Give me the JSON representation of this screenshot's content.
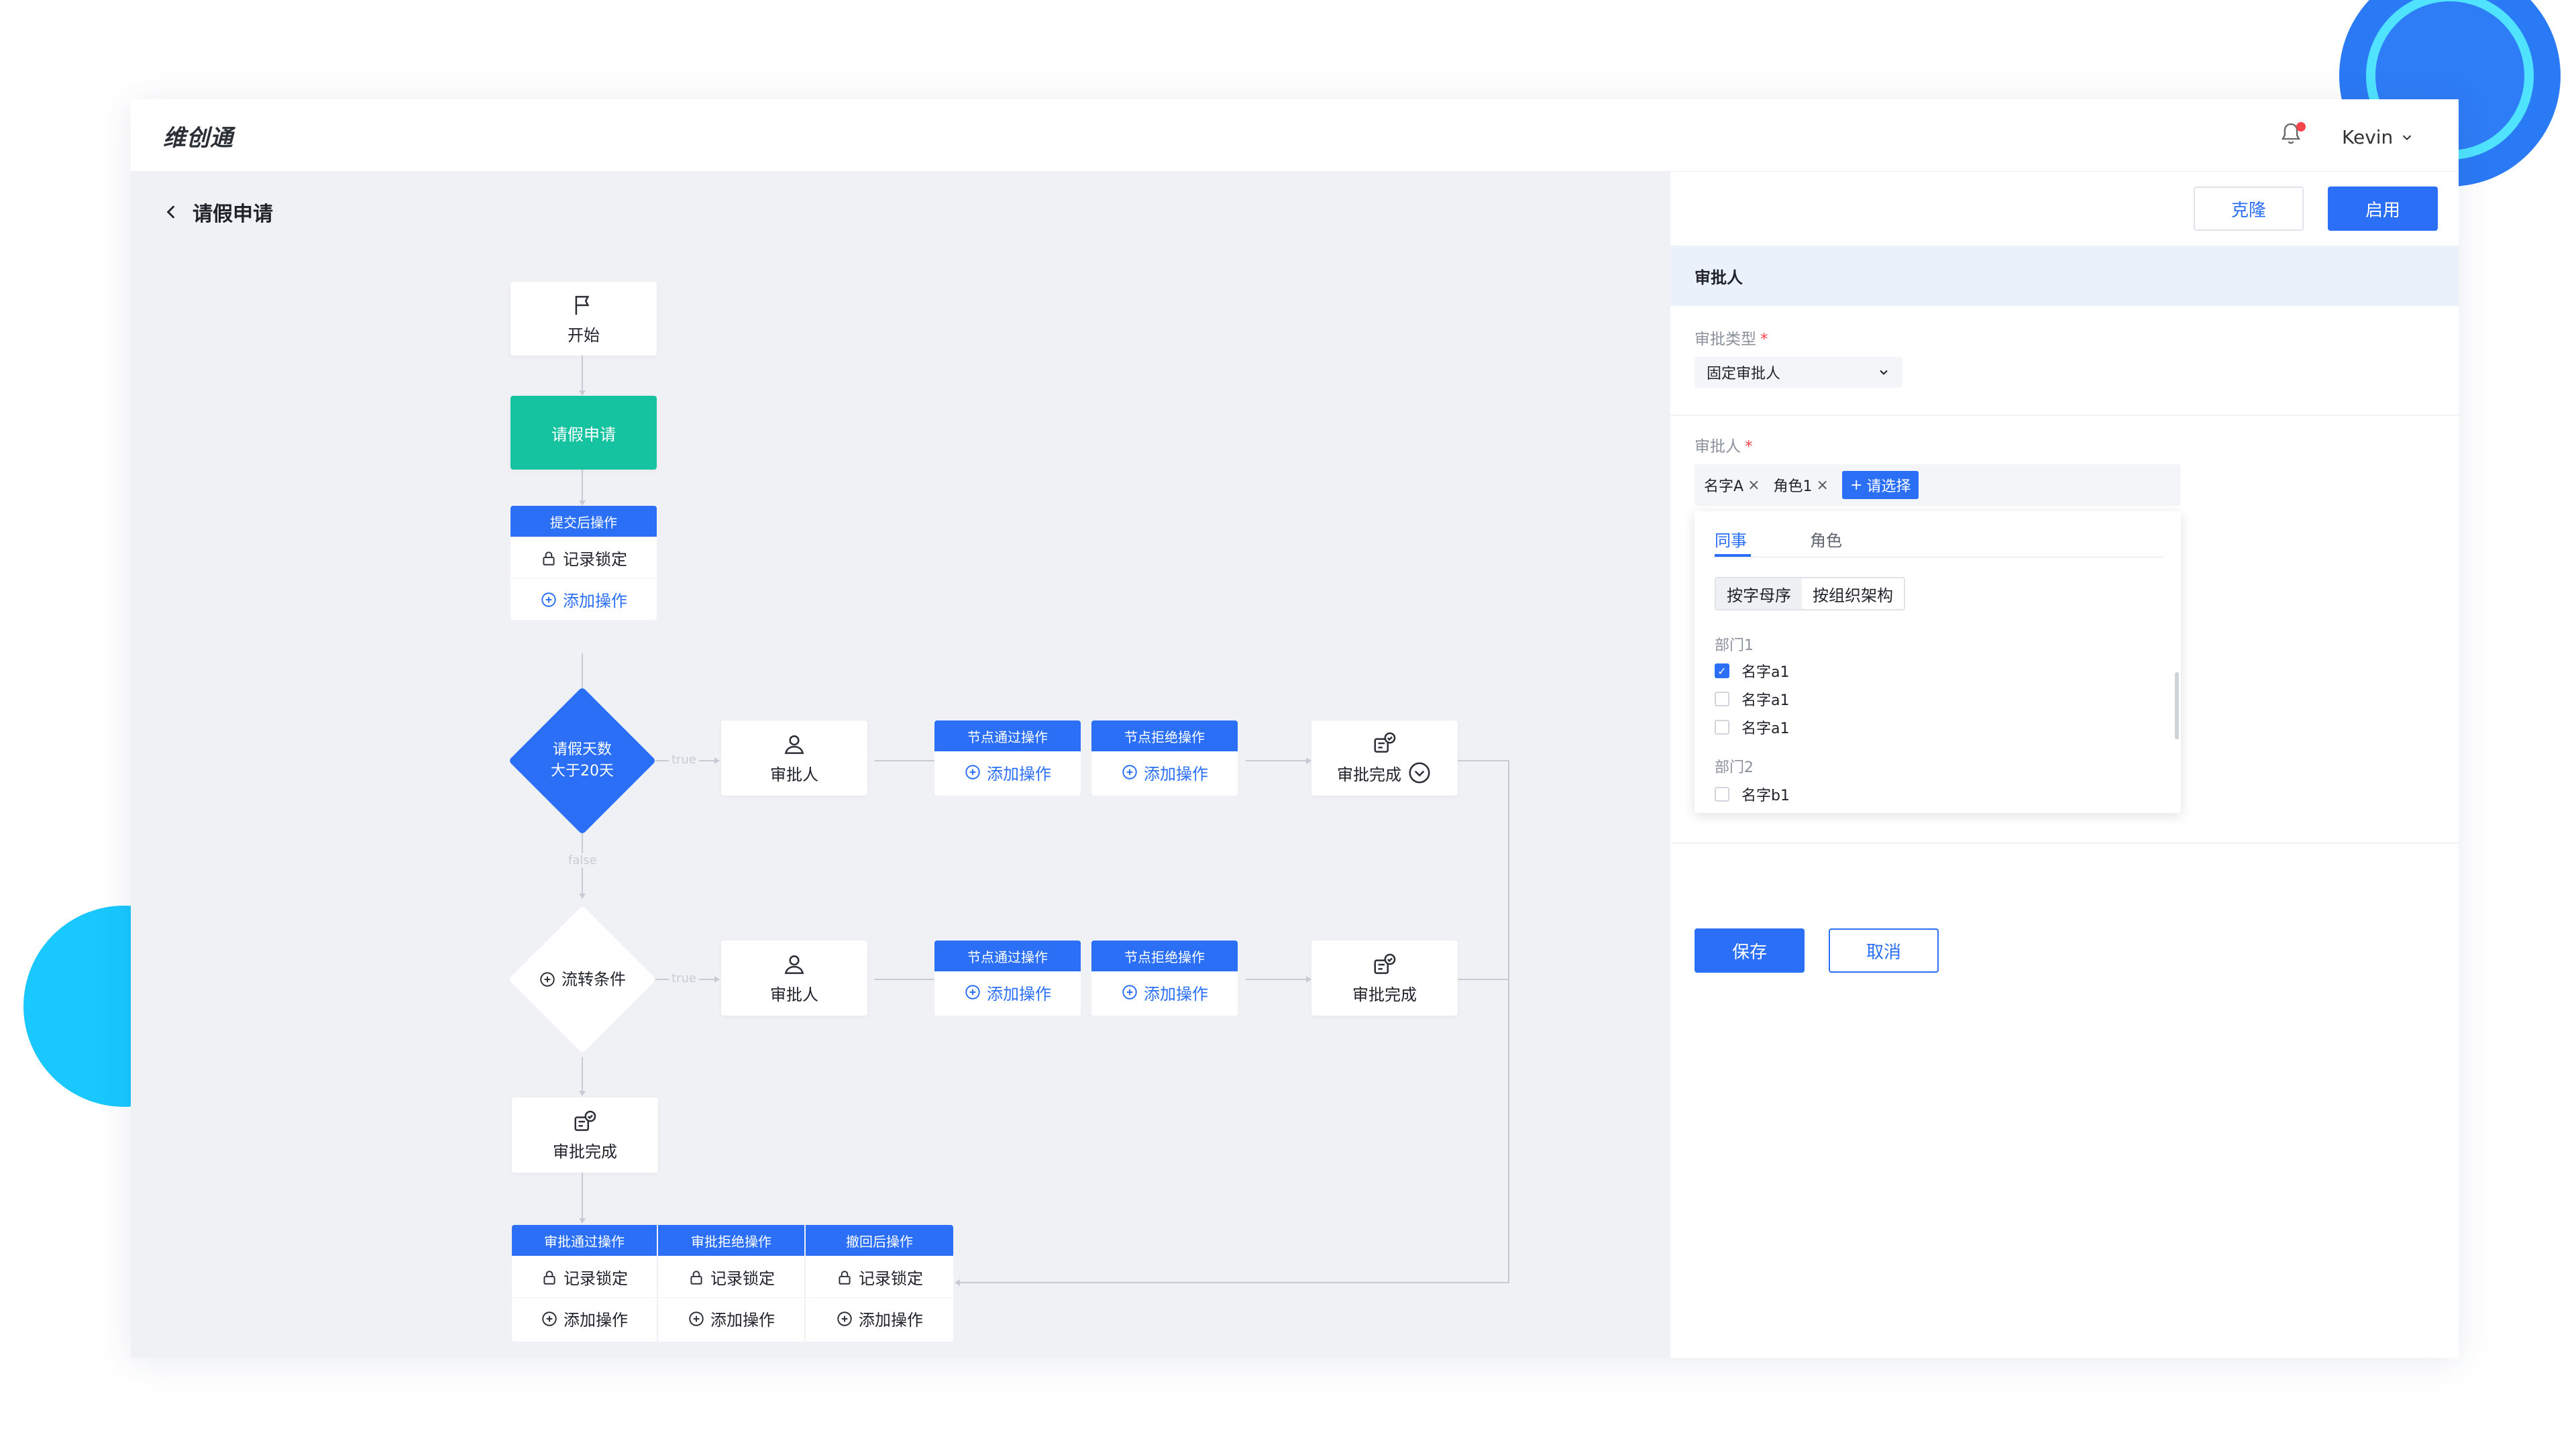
{
  "app": {
    "logo": "维创通",
    "user": "Kevin"
  },
  "page": {
    "title": "请假申请"
  },
  "panel": {
    "clone_label": "克隆",
    "enable_label": "启用",
    "section_title": "审批人",
    "approve_type_label": "审批类型",
    "approve_type_value": "固定审批人",
    "approver_label": "审批人",
    "required_mark": "*",
    "tags": [
      "名字A",
      "角色1"
    ],
    "pick_label": "请选择",
    "dropdown": {
      "tabs": [
        "同事",
        "角色"
      ],
      "segments": [
        "按字母序",
        "按组织架构"
      ],
      "dept1": "部门1",
      "dept2": "部门2",
      "members1": [
        {
          "name": "名字a1",
          "checked": true
        },
        {
          "name": "名字a1",
          "checked": false
        },
        {
          "name": "名字a1",
          "checked": false
        }
      ],
      "members2": [
        {
          "name": "名字b1",
          "checked": false
        }
      ]
    },
    "save_label": "保存",
    "cancel_label": "取消"
  },
  "flow": {
    "start": "开始",
    "apply": "请假申请",
    "submit_ops_title": "提交后操作",
    "record_lock": "记录锁定",
    "add_op": "添加操作",
    "cond1_line1": "请假天数",
    "cond1_line2": "大于20天",
    "cond2": "流转条件",
    "true_label": "true",
    "false_label": "false",
    "approver": "审批人",
    "pass_ops_title": "节点通过操作",
    "reject_ops_title": "节点拒绝操作",
    "done": "审批完成",
    "final_pass": "审批通过操作",
    "final_reject": "审批拒绝操作",
    "final_revoke": "撤回后操作"
  },
  "colors": {
    "primary": "#2a6ff5",
    "green": "#16c3a0",
    "canvas_bg": "#eff1f4"
  }
}
